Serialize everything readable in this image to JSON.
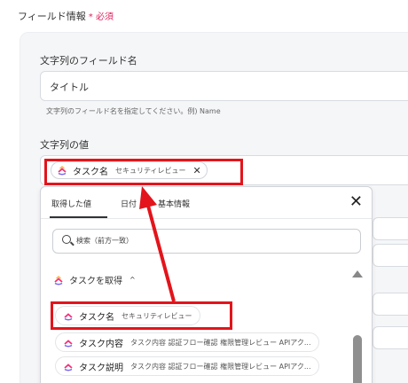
{
  "header": {
    "title": "フィールド情報",
    "required": "* 必須"
  },
  "field_name": {
    "label": "文字列のフィールド名",
    "value": "タイトル",
    "hint": "文字列のフィールド名を指定してください。例) Name"
  },
  "field_value": {
    "label": "文字列の値",
    "chip": {
      "title": "タスク名",
      "sub": "セキュリティレビュー",
      "close": "✕"
    }
  },
  "popup": {
    "tabs": [
      "取得した値",
      "日付",
      "基本情報"
    ],
    "close": "✕",
    "search_placeholder": "検索（前方一致）",
    "group": {
      "label": "タスクを取得",
      "chevron": "^"
    },
    "items": [
      {
        "title": "タスク名",
        "sub": "セキュリティレビュー"
      },
      {
        "title": "タスク内容",
        "sub": "タスク内容 認証フロー確認 権限管理レビュー APIアク..."
      },
      {
        "title": "タスク説明",
        "sub": "タスク内容 認証フロー確認 権限管理レビュー APIアク..."
      }
    ]
  },
  "colors": {
    "highlight": "#e3141b",
    "logo_pink": "#f2317a",
    "logo_purple": "#7b68ee",
    "logo_orange": "#ffb43a"
  }
}
